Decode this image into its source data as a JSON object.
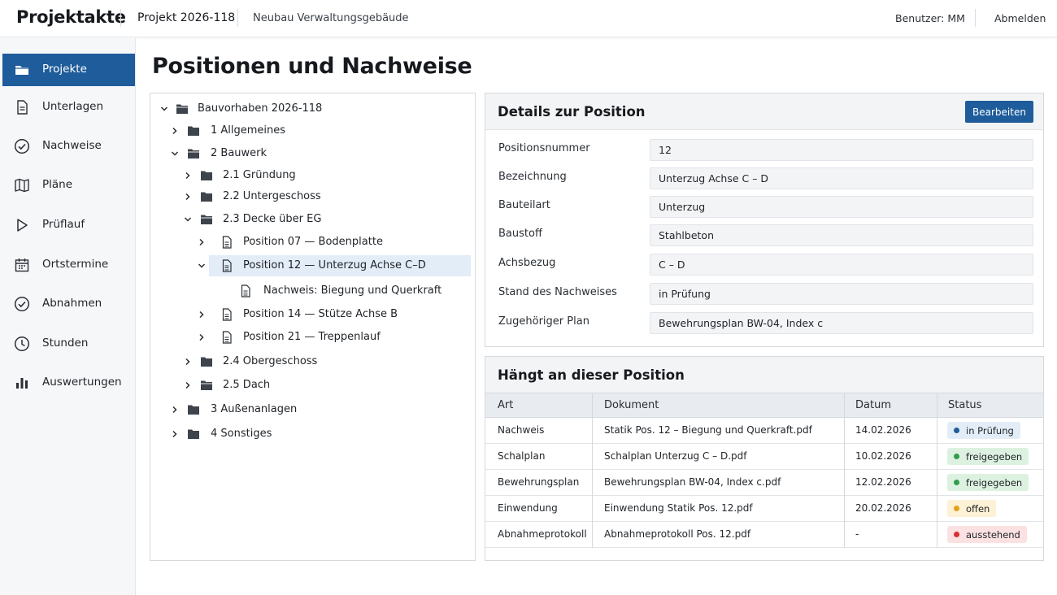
{
  "topbar": {
    "brand": "Projektakte",
    "project": "Projekt 2026-118",
    "building": "Neubau Verwaltungsgebäude",
    "user": "Benutzer: MM",
    "logout": "Abmelden"
  },
  "sidebar": {
    "items": [
      {
        "label": "Projekte",
        "icon": "folder-icon",
        "active": true
      },
      {
        "label": "Unterlagen",
        "icon": "document-icon"
      },
      {
        "label": "Nachweise",
        "icon": "check-circle-icon"
      },
      {
        "label": "Pläne",
        "icon": "map-icon"
      },
      {
        "label": "Prüflauf",
        "icon": "play-icon"
      },
      {
        "label": "Ortstermine",
        "icon": "calendar-icon"
      },
      {
        "label": "Abnahmen",
        "icon": "check-circle-icon"
      },
      {
        "label": "Stunden",
        "icon": "clock-icon"
      },
      {
        "label": "Auswertungen",
        "icon": "bar-chart-icon"
      }
    ]
  },
  "main": {
    "title": "Positionen und Nachweise"
  },
  "tree": {
    "nodes": [
      {
        "label": "Bauvorhaben 2026-118",
        "level": 0,
        "expanded": true,
        "type": "folder-open"
      },
      {
        "label": "1  Allgemeines",
        "level": 1,
        "expanded": false,
        "type": "folder"
      },
      {
        "label": "2  Bauwerk",
        "level": 1,
        "expanded": true,
        "type": "folder-open"
      },
      {
        "label": "2.1  Gründung",
        "level": 2,
        "expanded": false,
        "type": "folder"
      },
      {
        "label": "2.2  Untergeschoss",
        "level": 2,
        "expanded": false,
        "type": "folder"
      },
      {
        "label": "2.3  Decke über EG",
        "level": 2,
        "expanded": true,
        "type": "folder-open"
      },
      {
        "label": "Position 07  —  Bodenplatte",
        "level": 3,
        "expanded": false,
        "type": "doc"
      },
      {
        "label": "Position 12  —  Unterzug Achse C–D",
        "level": 3,
        "expanded": true,
        "type": "doc",
        "selected": true
      },
      {
        "label": "Nachweis: Biegung und Querkraft",
        "level": 4,
        "type": "doc"
      },
      {
        "label": "Position 14  —  Stütze Achse B",
        "level": 3,
        "expanded": false,
        "type": "doc"
      },
      {
        "label": "Position 21  —  Treppenlauf",
        "level": 3,
        "expanded": false,
        "type": "doc"
      },
      {
        "label": "2.4  Obergeschoss",
        "level": 2,
        "expanded": false,
        "type": "folder"
      },
      {
        "label": "2.5  Dach",
        "level": 2,
        "expanded": false,
        "type": "folder-open"
      },
      {
        "label": "3  Außenanlagen",
        "level": 1,
        "expanded": false,
        "type": "folder"
      },
      {
        "label": "4  Sonstiges",
        "level": 1,
        "expanded": false,
        "type": "folder"
      }
    ]
  },
  "details": {
    "title": "Details zur Position",
    "edit_label": "Bearbeiten",
    "fields": [
      {
        "label": "Positionsnummer",
        "value": "12"
      },
      {
        "label": "Bezeichnung",
        "value": "Unterzug Achse C – D"
      },
      {
        "label": "Bauteilart",
        "value": "Unterzug"
      },
      {
        "label": "Baustoff",
        "value": "Stahlbeton"
      },
      {
        "label": "Achsbezug",
        "value": "C – D"
      },
      {
        "label": "Stand des Nachweises",
        "value": "in Prüfung"
      },
      {
        "label": "Zugehöriger Plan",
        "value": "Bewehrungsplan BW-04, Index c"
      }
    ]
  },
  "attached": {
    "title": "Hängt an dieser Position",
    "columns": [
      "Art",
      "Dokument",
      "Datum",
      "Status"
    ],
    "rows": [
      {
        "art": "Nachweis",
        "dokument": "Statik Pos. 12 – Biegung und Querkraft.pdf",
        "datum": "14.02.2026",
        "status": "in Prüfung",
        "status_kind": "review"
      },
      {
        "art": "Schalplan",
        "dokument": "Schalplan Unterzug C – D.pdf",
        "datum": "10.02.2026",
        "status": "freigegeben",
        "status_kind": "approved"
      },
      {
        "art": "Bewehrungsplan",
        "dokument": "Bewehrungsplan BW-04, Index c.pdf",
        "datum": "12.02.2026",
        "status": "freigegeben",
        "status_kind": "approved"
      },
      {
        "art": "Einwendung",
        "dokument": "Einwendung Statik Pos. 12.pdf",
        "datum": "20.02.2026",
        "status": "offen",
        "status_kind": "open"
      },
      {
        "art": "Abnahmeprotokoll",
        "dokument": "Abnahmeprotokoll Pos. 12.pdf",
        "datum": "-",
        "status": "ausstehend",
        "status_kind": "pending"
      }
    ]
  },
  "colors": {
    "accent": "#1e5c9b",
    "selected_row": "#e3edf8",
    "status_review_bg": "#e3edf8",
    "status_review_dot": "#1e5c9b",
    "status_approved_bg": "#ddf1e0",
    "status_approved_dot": "#2e9e4a",
    "status_open_bg": "#fdf1d6",
    "status_open_dot": "#e3a21a",
    "status_pending_bg": "#fbe1e1",
    "status_pending_dot": "#d93030"
  }
}
